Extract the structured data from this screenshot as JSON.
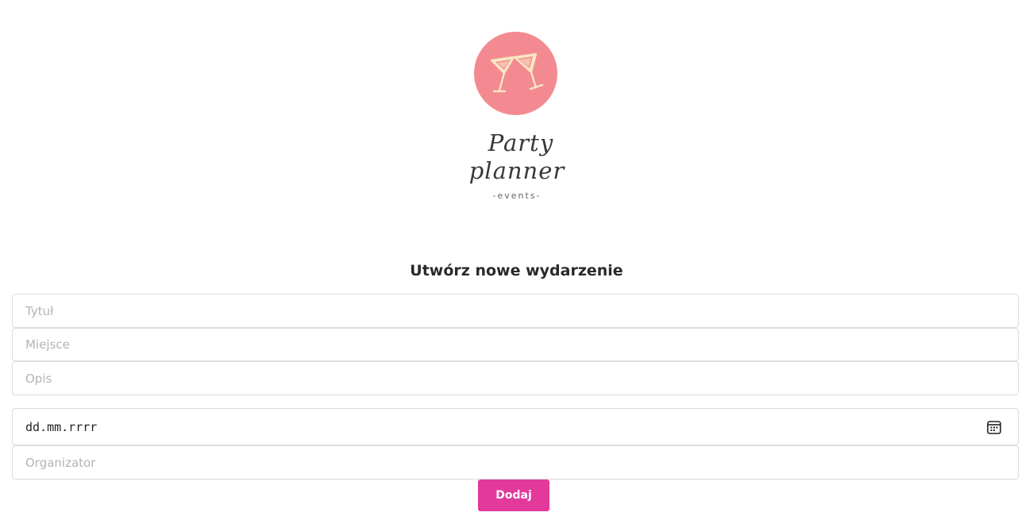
{
  "logo": {
    "icon": "cocktail-glasses-icon",
    "circle_color": "#f48a91",
    "line1": "Party",
    "line2": "planner",
    "subline": "-events-"
  },
  "form": {
    "title": "Utwórz nowe wydarzenie",
    "title_placeholder": "Tytuł",
    "place_placeholder": "Miejsce",
    "description_placeholder": "Opis",
    "date_value": "dd.mm.rrrr",
    "date_icon": "calendar-icon",
    "organizer_placeholder": "Organizator",
    "submit_label": "Dodaj",
    "accent_color": "#e2399b"
  }
}
